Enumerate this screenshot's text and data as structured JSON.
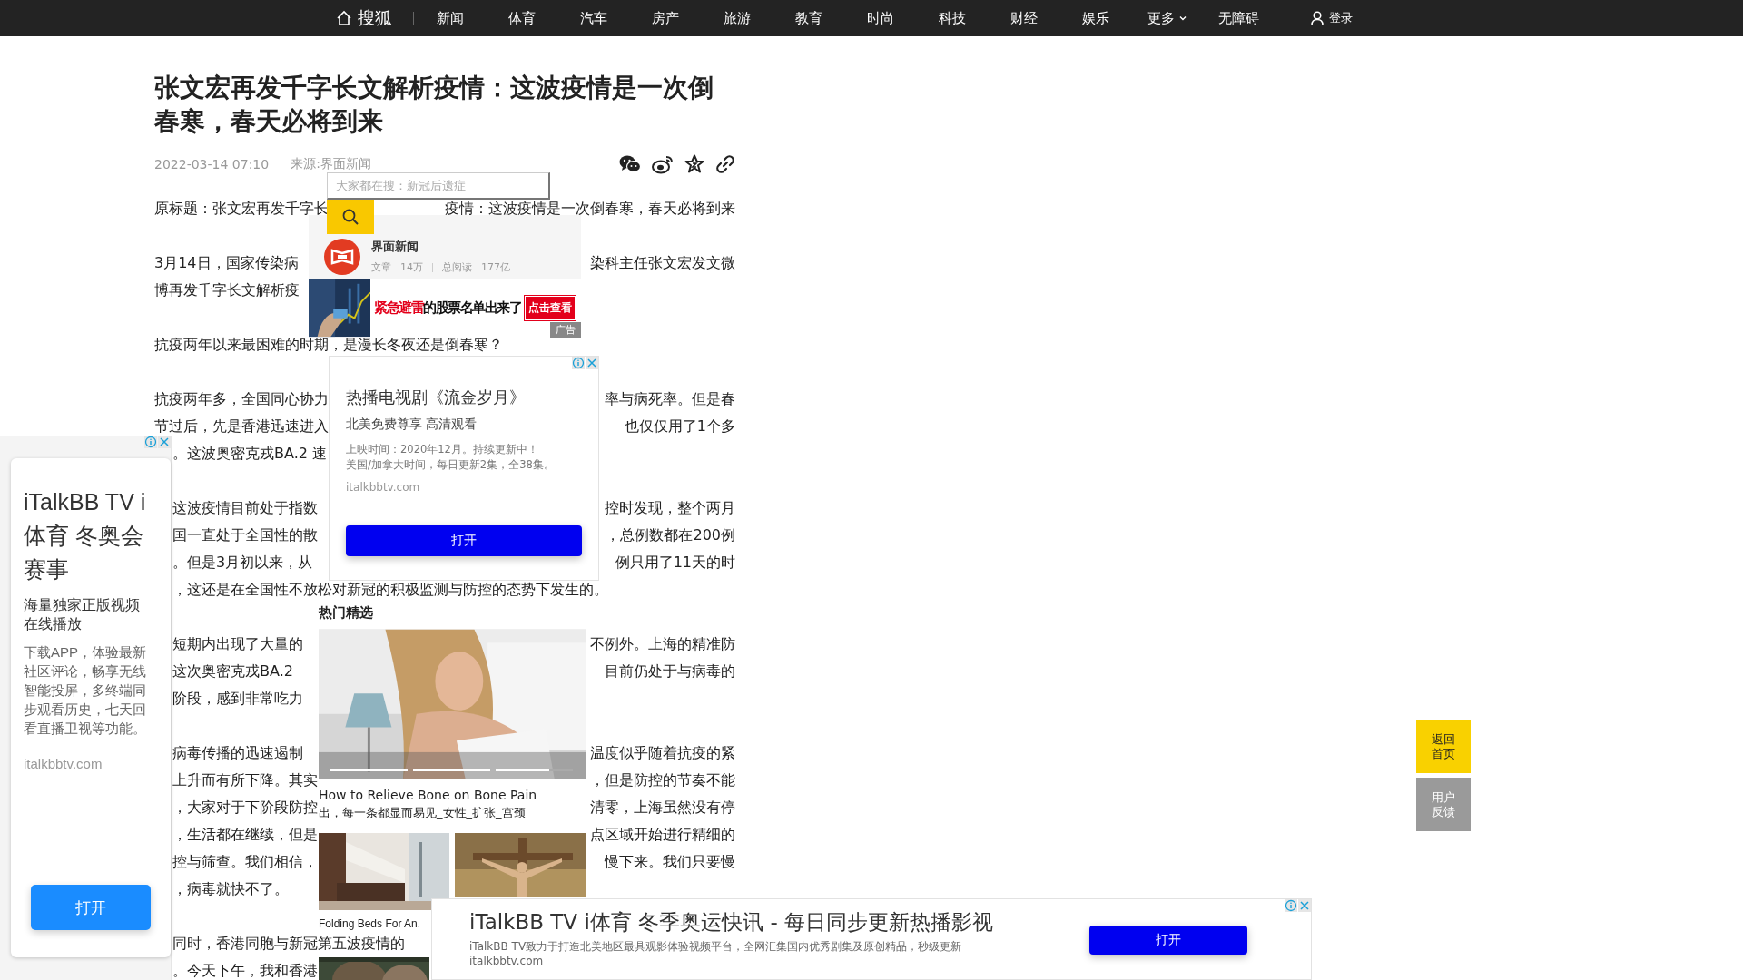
{
  "nav": {
    "logo": "搜狐",
    "items": [
      "新闻",
      "体育",
      "汽车",
      "房产",
      "旅游",
      "教育",
      "时尚",
      "科技",
      "财经",
      "娱乐"
    ],
    "more": "更多",
    "accessibility": "无障碍",
    "login": "登录"
  },
  "article": {
    "title": "张文宏再发千字长文解析疫情：这波疫情是一次倒春寒，春天必将到来",
    "date": "2022-03-14 07:10",
    "source": "来源:界面新闻",
    "paragraphs": [
      {
        "lines": [
          {
            "left": "原标题：张文宏再发千字长",
            "right": "疫情：这波疫情是一次倒春寒，春天必将到来"
          }
        ]
      },
      {
        "lines": [
          {
            "left": "3月14日，国家传染病",
            "right": "染科主任张文宏发文微"
          },
          {
            "left": "博再发千字长文解析疫"
          }
        ]
      },
      {
        "lines": [
          {
            "left": "抗疫两年以来最困难的时期，是漫长冬夜还是倒春寒？"
          }
        ]
      },
      {
        "lines": [
          {
            "left": "抗疫两年多，全国同心协力",
            "right": "率与病死率。但是春"
          },
          {
            "left": "节过后，先是香港迅速进入",
            "right": "也仅仅用了1个多"
          },
          {
            "left": "。这波奥密克戎BA.2 速"
          }
        ]
      },
      {
        "lines": [
          {
            "left": "这波疫情目前处于指数",
            "right": "控时发现，整个两月"
          },
          {
            "left": "国一直处于全国性的散",
            "right": "，总例数都在200例"
          },
          {
            "left": "。但是3月初以来，从",
            "right": "例只用了11天的时"
          },
          {
            "left": "，这还是在全国性不放松对新冠的积极监测与防控的态势下发生的。"
          }
        ]
      },
      {
        "lines": [
          {
            "left": "短期内出现了大量的",
            "right": "不例外。上海的精准防"
          },
          {
            "left": "这次奥密克戎BA.2",
            "right": "目前仍处于与病毒的"
          },
          {
            "left": "阶段，感到非常吃力"
          }
        ]
      },
      {
        "lines": [
          {
            "left": "病毒传播的迅速遏制",
            "right": "温度似乎随着抗疫的紧"
          },
          {
            "left": "上升而有所下降。其实",
            "right": "，但是防控的节奏不能"
          },
          {
            "left": "，大家对于下阶段防控",
            "right": "清零，上海虽然没有停"
          },
          {
            "left": "，生活都在继续，但是",
            "right": "点区域开始进行精细的"
          },
          {
            "left": "控与筛查。我们相信，",
            "right": "慢下来。我们只要慢"
          },
          {
            "left": "，病毒就快不了。"
          }
        ]
      },
      {
        "lines": [
          {
            "left": "同时，香港同胞与新冠第五波疫情的"
          },
          {
            "left": "。今天下午，我和香港"
          }
        ]
      }
    ]
  },
  "search": {
    "placeholder": "大家都在搜：新冠后遗症"
  },
  "media": {
    "name": "界面新闻",
    "stats": [
      {
        "label": "文章",
        "value": "14万"
      },
      {
        "label": "总阅读",
        "value": "177亿"
      }
    ]
  },
  "banner": {
    "highlight": "紧急避雷",
    "headline": "的股票名单出来了",
    "cta": "点击查看",
    "tag": "广告"
  },
  "ad_card": {
    "title": "热播电视剧《流金岁月》",
    "subtitle": "北美免费尊享 高清观看",
    "details": [
      "上映时间：2020年12月。持续更新中！",
      "美国/加拿大时间，每日更新2集，全38集。"
    ],
    "url": "italkbbtv.com",
    "button": "打开"
  },
  "hot_picks": {
    "heading": "热门精选",
    "feature": {
      "caption": "How to Relieve Bone on Bone Pain",
      "caption_2": "出，每一条都显而易见_女性_扩张_宫颈"
    },
    "items": [
      {
        "caption": "Folding Beds For An."
      }
    ]
  },
  "left_ad": {
    "title": "iTalkBB TV i体育 冬奥会赛事",
    "subtitle": "海量独家正版视频在线播放",
    "description": "下载APP，体验最新社区评论，畅享无线智能投屏，多终端同步观看历史，七天回看直播卫视等功能。",
    "url": "italkbbtv.com",
    "button": "打开"
  },
  "bottom_ad": {
    "title": "iTalkBB TV i体育 冬季奥运快讯 - 每日同步更新热播影视",
    "description": "iTalkBB TV致力于打造北美地区最具观影体验视频平台，全网汇集国内优秀剧集及原创精品，秒级更新",
    "url": "italkbbtv.com",
    "button": "打开"
  },
  "float_buttons": [
    {
      "label": "返回首页",
      "kind": "primary"
    },
    {
      "label": "用户反馈",
      "kind": "secondary"
    }
  ]
}
